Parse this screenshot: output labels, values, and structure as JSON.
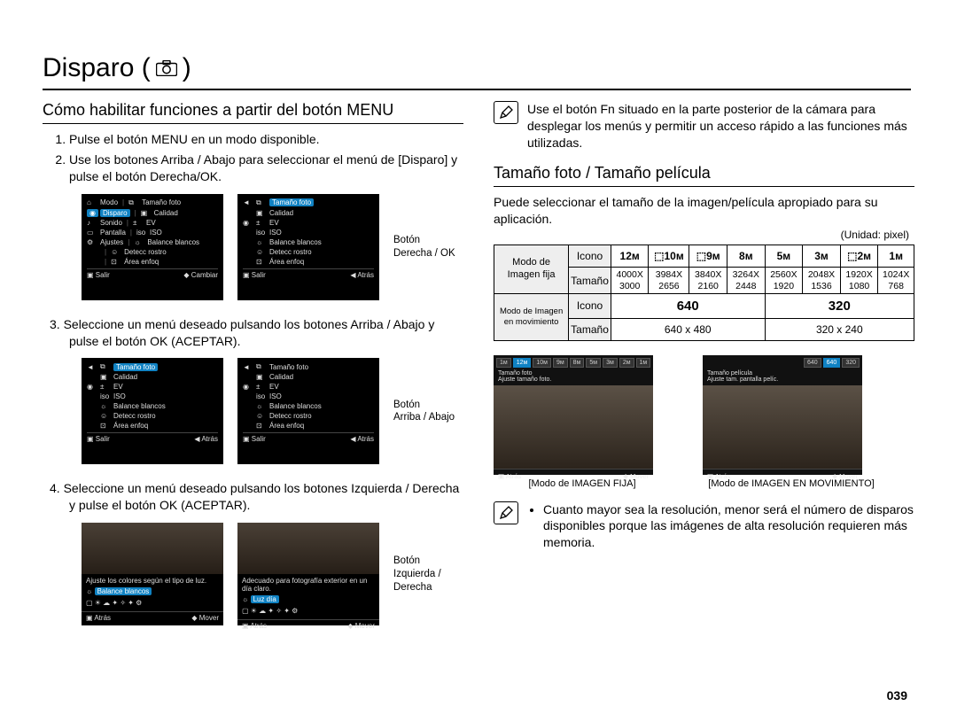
{
  "page_number": "039",
  "title": "Disparo (",
  "title_suffix": ")",
  "left": {
    "section_title": "Cómo habilitar funciones a partir del botón MENU",
    "step1": "Pulse el botón MENU en un modo disponible.",
    "step2": "Use los botones Arriba / Abajo para seleccionar el menú de [Disparo] y pulse el botón Derecha/OK.",
    "step3": "Seleccione un menú deseado pulsando los botones Arriba / Abajo y pulse el botón OK (ACEPTAR).",
    "step4": "Seleccione un menú deseado pulsando los botones Izquierda / Derecha y pulse el botón OK (ACEPTAR).",
    "label_right_ok": "Botón\nDerecha / OK",
    "label_updown": "Botón\nArriba / Abajo",
    "label_leftright": "Botón\nIzquierda /\nDerecha",
    "screenA": {
      "items_left": [
        "Modo",
        "Disparo",
        "Sonido",
        "Pantalla",
        "Ajustes"
      ],
      "items_right": [
        "Tamaño foto",
        "Calidad",
        "EV",
        "ISO",
        "Balance blancos",
        "Detecc rostro",
        "Área enfoq"
      ],
      "footer_exit": "Salir",
      "footer_change": "Cambiar"
    },
    "screenB": {
      "items": [
        "Tamaño foto",
        "Calidad",
        "EV",
        "ISO",
        "Balance blancos",
        "Detecc rostro",
        "Área enfoq"
      ],
      "footer_exit": "Salir",
      "footer_back": "Atrás"
    },
    "screenC": {
      "top_line": "Ajuste los colores según el tipo de luz.",
      "label_wb": "Balance blancos",
      "footer_back": "Atrás",
      "footer_move": "Mover"
    },
    "screenD": {
      "top_line": "Adecuado para fotografía exterior en un día claro.",
      "label_day": "Luz día",
      "footer_back": "Atrás",
      "footer_move": "Mover"
    }
  },
  "right": {
    "tip_text": "Use el botón Fn situado en la parte posterior de la cámara para desplegar los menús y permitir un acceso rápido a las funciones más utilizadas.",
    "section_title": "Tamaño foto / Tamaño película",
    "intro": "Puede seleccionar el tamaño de la imagen/película apropiado para su aplicación.",
    "unit_label": "(Unidad: pixel)",
    "table_still_head": "Modo de Imagen fija",
    "row_icon": "Icono",
    "row_size": "Tamaño",
    "still_icons": [
      "12ᴍ",
      "⬚10ᴍ",
      "⬚9ᴍ",
      "8ᴍ",
      "5ᴍ",
      "3ᴍ",
      "⬚2ᴍ",
      "1ᴍ"
    ],
    "still_sizes": [
      "4000X 3000",
      "3984X 2656",
      "3840X 2160",
      "3264X 2448",
      "2560X 1920",
      "2048X 1536",
      "1920X 1080",
      "1024X 768"
    ],
    "table_movie_head": "Modo de Imagen en movimiento",
    "movie_icons": [
      "640",
      "320"
    ],
    "movie_sizes": [
      "640 x 480",
      "320 x 240"
    ],
    "demo_still_cap": "[Modo de IMAGEN FIJA]",
    "demo_movie_cap": "[Modo de IMAGEN EN MOVIMIENTO]",
    "demo_still": {
      "chips": [
        "1ᴍ",
        "12ᴍ",
        "10ᴍ",
        "9ᴍ",
        "8ᴍ",
        "5ᴍ",
        "3ᴍ",
        "2ᴍ",
        "1ᴍ"
      ],
      "line1": "Tamaño foto",
      "line2": "Ajuste tamaño foto.",
      "footer_back": "Atrás",
      "footer_move": "Mover"
    },
    "demo_movie": {
      "chips": [
        "640",
        "640",
        "320"
      ],
      "line1": "Tamaño película",
      "line2": "Ajuste tam. pantalla pelíc.",
      "footer_back": "Atrás",
      "footer_move": "Mover"
    },
    "note_bullet": "Cuanto mayor sea la resolución, menor será el número de disparos disponibles porque las imágenes de alta resolución requieren más memoria."
  },
  "chart_data": {
    "type": "table",
    "title": "Tamaño foto / Tamaño película (Unidad: pixel)",
    "still_image_mode": {
      "icons": [
        "12M",
        "10M (wide)",
        "9M (wide)",
        "8M",
        "5M",
        "3M",
        "2M (wide)",
        "1M"
      ],
      "resolutions": [
        "4000x3000",
        "3984x2656",
        "3840x2160",
        "3264x2448",
        "2560x1920",
        "2048x1536",
        "1920x1080",
        "1024x768"
      ]
    },
    "movie_mode": {
      "icons": [
        "640",
        "320"
      ],
      "resolutions": [
        "640x480",
        "320x240"
      ]
    }
  }
}
